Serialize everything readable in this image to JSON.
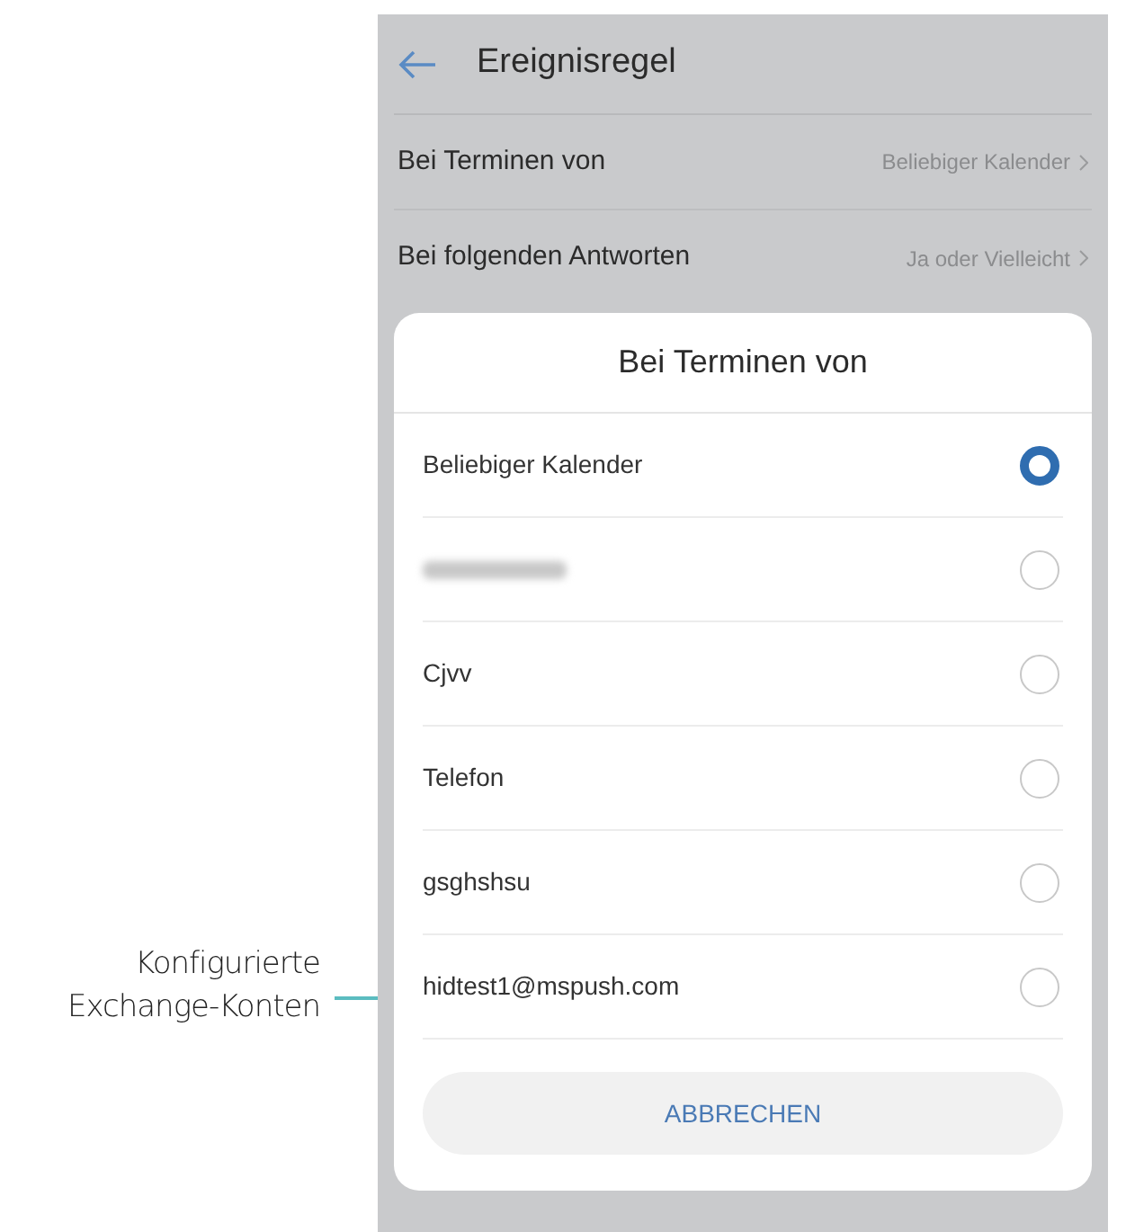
{
  "header": {
    "title": "Ereignisregel"
  },
  "settings": [
    {
      "label": "Bei Terminen von",
      "value": "Beliebiger Kalender"
    },
    {
      "label": "Bei folgenden Antworten",
      "value": "Ja oder Vielleicht"
    }
  ],
  "dialog": {
    "title": "Bei Terminen von",
    "options": [
      {
        "kind": "text",
        "label": "Beliebiger Kalender",
        "selected": true
      },
      {
        "kind": "redacted",
        "selected": false
      },
      {
        "kind": "text",
        "label": "Cjvv",
        "selected": false
      },
      {
        "kind": "text",
        "label": "Telefon",
        "selected": false
      },
      {
        "kind": "text",
        "label": "gsghshsu",
        "selected": false
      },
      {
        "kind": "text",
        "label": "hidtest1@mspush.com",
        "selected": false
      }
    ],
    "cancel": "ABBRECHEN"
  },
  "callout": {
    "lines": [
      "Konfigurierte",
      "Exchange-Konten"
    ]
  }
}
